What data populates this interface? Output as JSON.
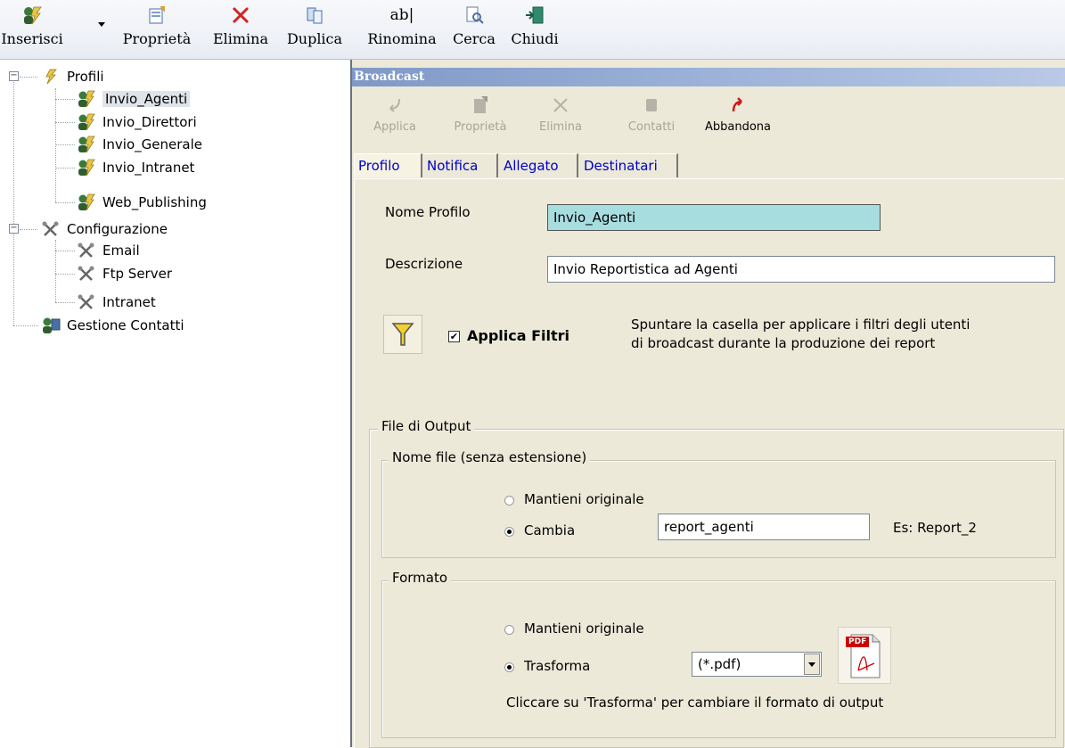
{
  "toolbar": {
    "inserisci": "Inserisci",
    "proprieta": "Proprietà",
    "elimina": "Elimina",
    "duplica": "Duplica",
    "rinomina": "Rinomina",
    "cerca": "Cerca",
    "chiudi": "Chiudi",
    "rinomina_icon_text": "ab|"
  },
  "tree": {
    "profili": "Profili",
    "profiles": [
      "Invio_Agenti",
      "Invio_Direttori",
      "Invio_Generale",
      "Invio_Intranet",
      "Web_Publishing"
    ],
    "configurazione": "Configurazione",
    "config_items": [
      "Email",
      "Ftp Server",
      "Intranet"
    ],
    "gestione_contatti": "Gestione Contatti",
    "expanded_sign": "−"
  },
  "panel": {
    "title": "Broadcast",
    "actions": {
      "applica": "Applica",
      "proprieta": "Proprietà",
      "elimina": "Elimina",
      "contatti": "Contatti",
      "abbandona": "Abbandona"
    },
    "tabs": [
      "Profilo",
      "Notifica",
      "Allegato",
      "Destinatari"
    ],
    "form": {
      "nome_profilo_label": "Nome Profilo",
      "nome_profilo_value": "Invio_Agenti",
      "descrizione_label": "Descrizione",
      "descrizione_value": "Invio Reportistica ad Agenti",
      "applica_filtri_label": "Applica Filtri",
      "applica_filtri_checked": true,
      "filtri_help_1": "Spuntare la casella per applicare i filtri degli utenti",
      "filtri_help_2": "di broadcast durante la produzione dei report",
      "file_output_legend": "File di Output",
      "nome_file_legend": "Nome file (senza estensione)",
      "mantieni_originale": "Mantieni originale",
      "cambia": "Cambia",
      "nome_file_value": "report_agenti",
      "esempio": "Es: Report_2",
      "formato_legend": "Formato",
      "formato_mantieni": "Mantieni originale",
      "trasforma": "Trasforma",
      "formato_value": "(*.pdf)",
      "formato_help": "Cliccare su 'Trasforma' per cambiare il formato di output",
      "pdf_badge": "PDF"
    }
  }
}
